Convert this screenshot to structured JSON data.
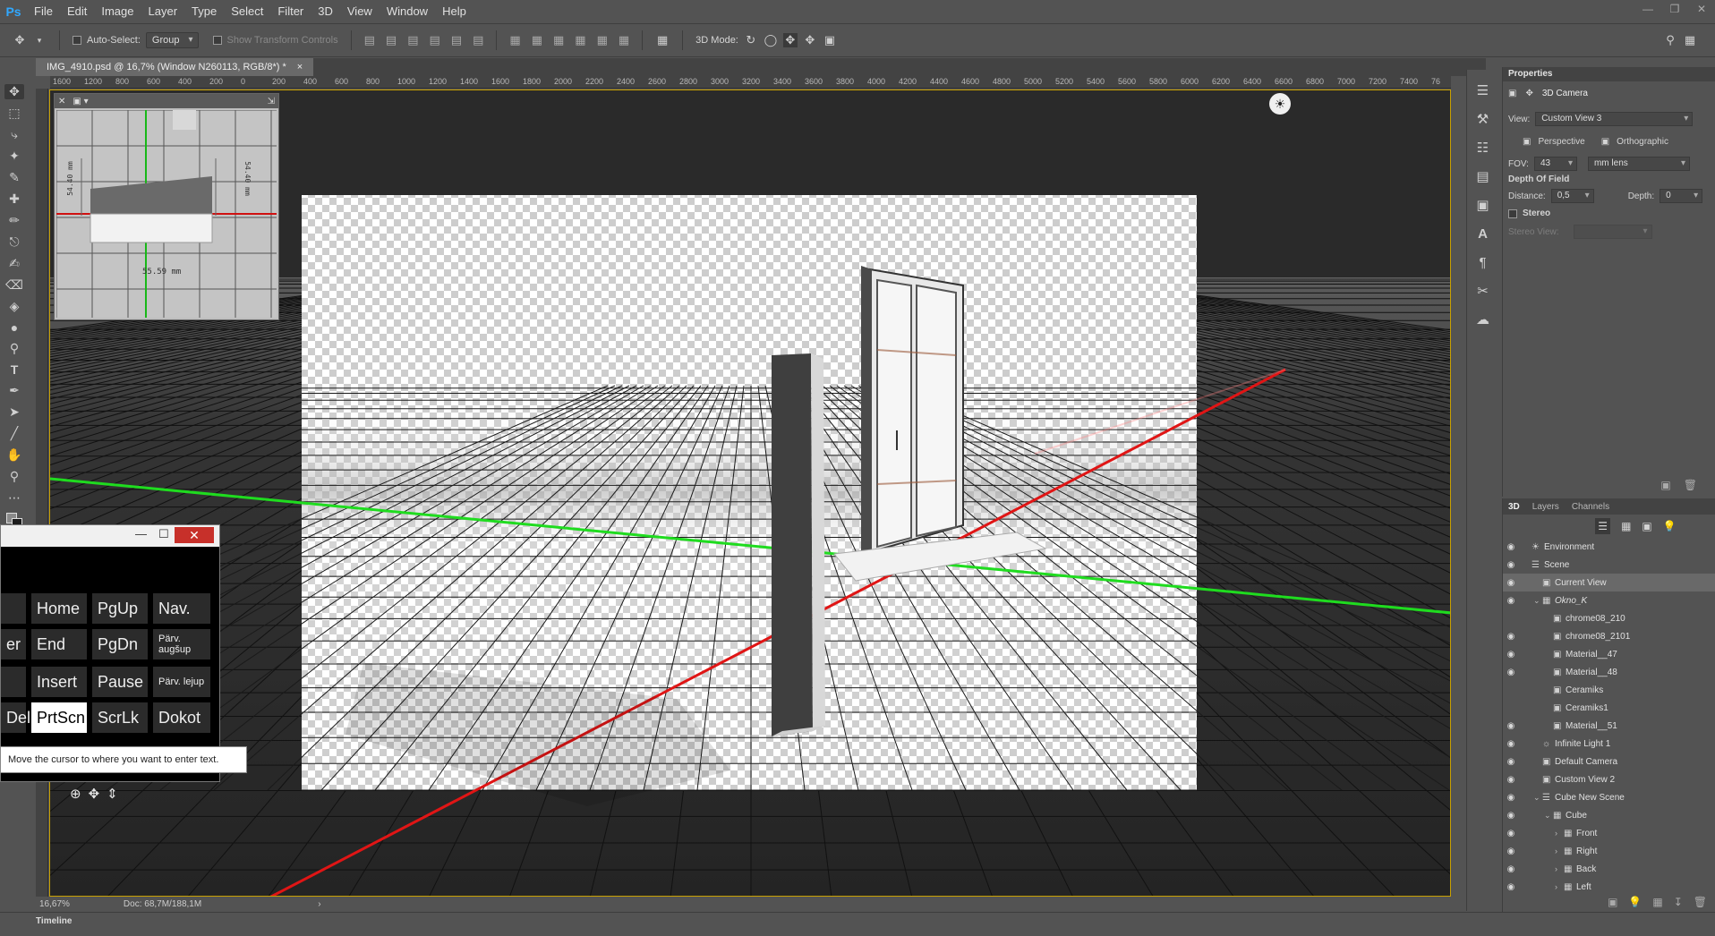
{
  "app": {
    "logo": "Ps"
  },
  "menu": [
    "File",
    "Edit",
    "Image",
    "Layer",
    "Type",
    "Select",
    "Filter",
    "3D",
    "View",
    "Window",
    "Help"
  ],
  "options": {
    "auto_select_label": "Auto-Select:",
    "auto_select_value": "Group",
    "show_transform": "Show Transform Controls",
    "mode_label": "3D Mode:"
  },
  "document": {
    "tab_title": "IMG_4910.psd @ 16,7% (Window N260113, RGB/8*) *",
    "close": "×"
  },
  "ruler_labels": [
    "1600",
    "1200",
    "800",
    "600",
    "400",
    "200",
    "0",
    "200",
    "400",
    "600",
    "800",
    "1000",
    "1200",
    "1400",
    "1600",
    "1800",
    "2000",
    "2200",
    "2400",
    "2600",
    "2800",
    "3000",
    "3200",
    "3400",
    "3600",
    "3800",
    "4000",
    "4200",
    "4400",
    "4600",
    "4800",
    "5000",
    "5200",
    "5400",
    "5600",
    "5800",
    "6000",
    "6200",
    "6400",
    "6600",
    "6800",
    "7000",
    "7200",
    "7400",
    "76"
  ],
  "mini_viewer": {
    "measure_h": "55.59 mm",
    "measure_v1": "54.40 mm",
    "measure_v2": "54.40 mm"
  },
  "keyboard": {
    "rows": [
      [
        "Home",
        "PgUp",
        "Nav."
      ],
      [
        "End",
        "PgDn",
        "Pärv. augšup"
      ],
      [
        "Insert",
        "Pause",
        "Pärv. lejup"
      ],
      [
        "PrtScn",
        "ScrLk",
        "Dokot"
      ]
    ],
    "edge_left": [
      "er",
      "Del"
    ],
    "tooltip": "Move the cursor to where you want to enter text."
  },
  "status": {
    "zoom": "16,67%",
    "doc": "Doc: 68,7M/188,1M"
  },
  "timeline": {
    "label": "Timeline"
  },
  "properties": {
    "title": "Properties",
    "object": "3D Camera",
    "view_label": "View:",
    "view_value": "Custom View 3",
    "perspective": "Perspective",
    "orthographic": "Orthographic",
    "fov_label": "FOV:",
    "fov_value": "43",
    "lens_value": "mm lens",
    "dof": "Depth Of Field",
    "distance_label": "Distance:",
    "distance_value": "0,5",
    "depth_label": "Depth:",
    "depth_value": "0",
    "stereo": "Stereo",
    "stereo_view": "Stereo View:"
  },
  "layers_panel": {
    "tabs": [
      "3D",
      "Layers",
      "Channels"
    ],
    "items": [
      {
        "label": "Environment",
        "depth": 0
      },
      {
        "label": "Scene",
        "depth": 0
      },
      {
        "label": "Current View",
        "depth": 1
      },
      {
        "label": "Okno_K",
        "depth": 1
      },
      {
        "label": "chrome08_210",
        "depth": 2
      },
      {
        "label": "chrome08_2101",
        "depth": 2
      },
      {
        "label": "Material__47",
        "depth": 2
      },
      {
        "label": "Material__48",
        "depth": 2
      },
      {
        "label": "Ceramiks",
        "depth": 2
      },
      {
        "label": "Ceramiks1",
        "depth": 2
      },
      {
        "label": "Material__51",
        "depth": 2
      },
      {
        "label": "Infinite Light 1",
        "depth": 1
      },
      {
        "label": "Default Camera",
        "depth": 1
      },
      {
        "label": "Custom View 2",
        "depth": 1
      },
      {
        "label": "Cube New Scene",
        "depth": 1
      },
      {
        "label": "Cube",
        "depth": 2
      },
      {
        "label": "Front",
        "depth": 3
      },
      {
        "label": "Right",
        "depth": 3
      },
      {
        "label": "Back",
        "depth": 3
      },
      {
        "label": "Left",
        "depth": 3
      }
    ]
  }
}
